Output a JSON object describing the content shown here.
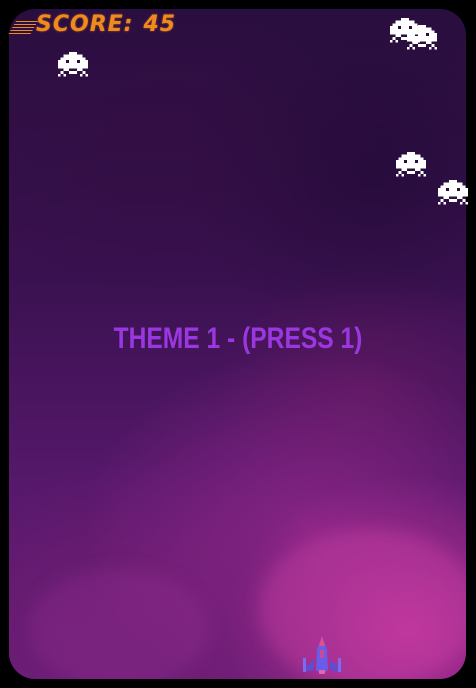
{
  "hud": {
    "score_label": "SCORE:",
    "score_value": "45",
    "score_color": "#f08a1c"
  },
  "message": {
    "text": "THEME 1 - (PRESS 1)",
    "color": "#9a37e0"
  },
  "enemies": {
    "icon": "space-invader-icon",
    "color": "#ffffff",
    "count": 6
  },
  "player": {
    "icon": "spaceship-icon"
  }
}
